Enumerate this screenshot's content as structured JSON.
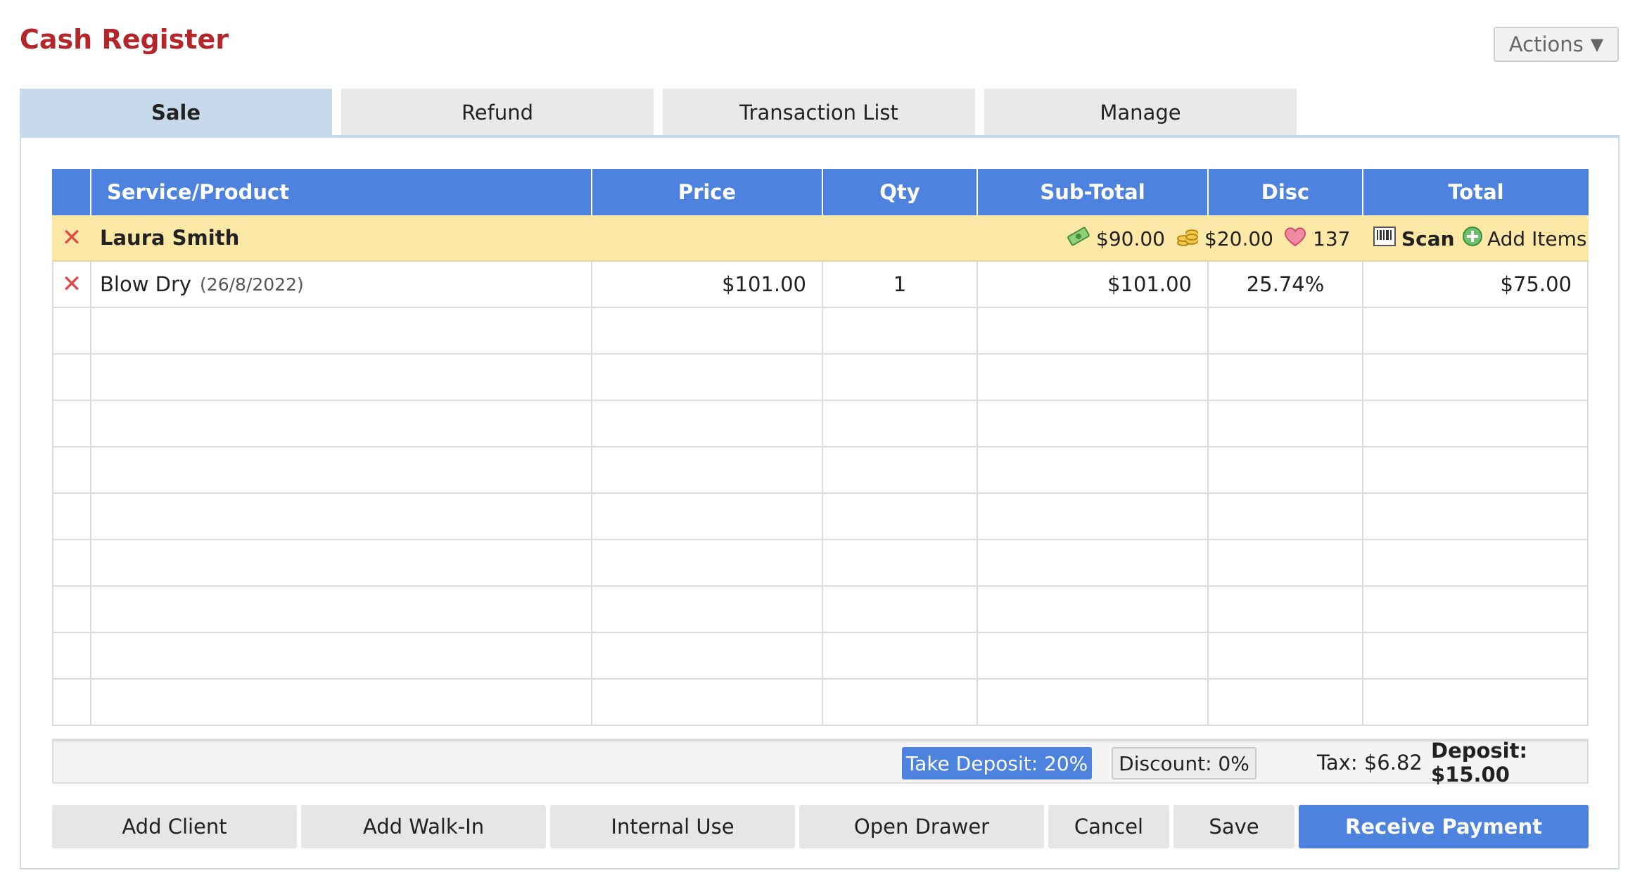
{
  "page": {
    "title": "Cash Register",
    "actions_label": "Actions"
  },
  "tabs": [
    {
      "label": "Sale",
      "active": true
    },
    {
      "label": "Refund"
    },
    {
      "label": "Transaction List"
    },
    {
      "label": "Manage"
    }
  ],
  "table": {
    "headers": [
      "Service/Product",
      "Price",
      "Qty",
      "Sub-Total",
      "Disc",
      "Total"
    ],
    "client": {
      "name": "Laura Smith",
      "cash_value": "$90.00",
      "coins_value": "$20.00",
      "points_value": "137",
      "scan_label": "Scan",
      "add_items_label": "Add Items"
    },
    "items": [
      {
        "name": "Blow Dry",
        "date": "(26/8/2022)",
        "price": "$101.00",
        "qty": "1",
        "subtotal": "$101.00",
        "disc": "25.74%",
        "total": "$75.00"
      }
    ],
    "empty_rows": 9
  },
  "footer": {
    "take_deposit": "Take Deposit: 20%",
    "discount": "Discount: 0%",
    "tax": "Tax: $6.82",
    "deposit": "Deposit: $15.00"
  },
  "buttons": {
    "add_client": "Add Client",
    "add_walkin": "Add Walk-In",
    "internal_use": "Internal Use",
    "open_drawer": "Open Drawer",
    "cancel": "Cancel",
    "save": "Save",
    "receive_payment": "Receive Payment"
  },
  "colors": {
    "accent": "#4d82df",
    "title": "#b3262a",
    "client_row": "#fbe8a6",
    "tab_active": "#c7daec"
  }
}
